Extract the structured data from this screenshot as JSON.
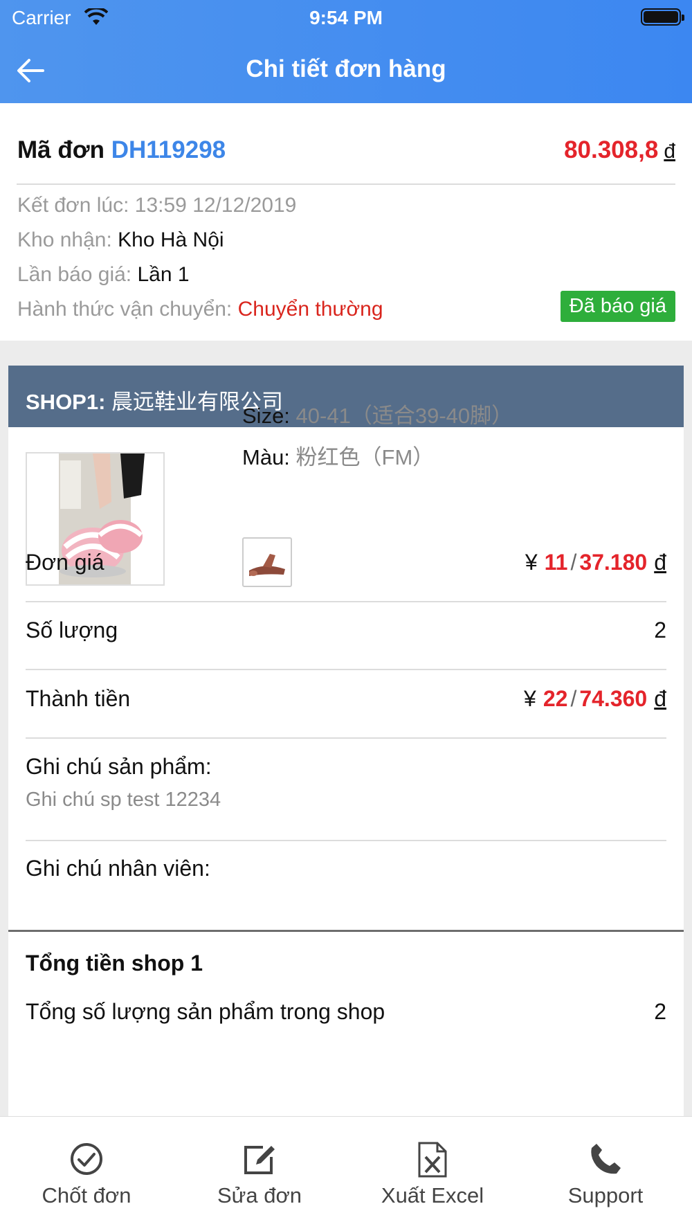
{
  "status_bar": {
    "carrier": "Carrier",
    "time": "9:54 PM"
  },
  "nav": {
    "title": "Chi tiết đơn hàng"
  },
  "order": {
    "id_label": "Mã đơn",
    "id_code": "DH119298",
    "total_value": "80.308,8",
    "currency": "đ",
    "created_label": "Kết đơn lúc:",
    "created_value": "13:59 12/12/2019",
    "warehouse_label": "Kho nhận:",
    "warehouse_value": "Kho Hà Nội",
    "quote_label": "Lần báo giá:",
    "quote_value": "Lần 1",
    "shipping_label": "Hành thức vận chuyển:",
    "shipping_value": "Chuyển thường",
    "status_badge": "Đã báo giá"
  },
  "shop": {
    "label": "SHOP1:",
    "name": "晨远鞋业有限公司",
    "product": {
      "size_label": "Size:",
      "size_value": "40-41（适合39-40脚）",
      "color_label": "Màu:",
      "color_value": "粉红色（FM）"
    },
    "unit_price": {
      "label": "Đơn giá",
      "yen_sign": "¥",
      "yen": "11",
      "sep": "/",
      "vnd": "37.180",
      "currency": "đ"
    },
    "quantity": {
      "label": "Số lượng",
      "value": "2"
    },
    "subtotal": {
      "label": "Thành tiền",
      "yen_sign": "¥",
      "yen": "22",
      "sep": "/",
      "vnd": "74.360",
      "currency": "đ"
    },
    "product_note": {
      "label": "Ghi chú sản phẩm:",
      "value": "Ghi chú sp test 12234"
    },
    "staff_note": {
      "label": "Ghi chú nhân viên:"
    },
    "shop_total": {
      "title": "Tổng tiền shop 1",
      "count_label": "Tổng số lượng sản phẩm trong shop",
      "count_value": "2"
    }
  },
  "tabbar": [
    {
      "label": "Chốt đơn",
      "icon": "check-circle-icon"
    },
    {
      "label": "Sửa đơn",
      "icon": "edit-icon"
    },
    {
      "label": "Xuất Excel",
      "icon": "excel-file-icon"
    },
    {
      "label": "Support",
      "icon": "phone-icon"
    }
  ],
  "colors": {
    "header": "#4a90ee",
    "accent_blue": "#3d86e8",
    "price_red": "#e4242b",
    "badge_green": "#2eae3b",
    "shop_header": "#556d8a"
  }
}
